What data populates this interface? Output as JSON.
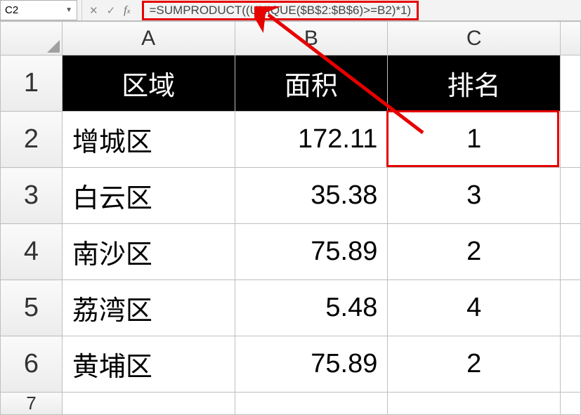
{
  "name_box": {
    "ref": "C2"
  },
  "formula_bar": {
    "formula": "=SUMPRODUCT((UNIQUE($B$2:$B$6)>=B2)*1)"
  },
  "col_headers": [
    "A",
    "B",
    "C"
  ],
  "row_headers": [
    "1",
    "2",
    "3",
    "4",
    "5",
    "6",
    "7"
  ],
  "header_row": {
    "A": "区域",
    "B": "面积",
    "C": "排名"
  },
  "rows": [
    {
      "A": "增城区",
      "B": "172.11",
      "C": "1"
    },
    {
      "A": "白云区",
      "B": "35.38",
      "C": "3"
    },
    {
      "A": "南沙区",
      "B": "75.89",
      "C": "2"
    },
    {
      "A": "荔湾区",
      "B": "5.48",
      "C": "4"
    },
    {
      "A": "黄埔区",
      "B": "75.89",
      "C": "2"
    }
  ],
  "selected_cell": "C2",
  "chart_data": {
    "type": "table",
    "columns": [
      "区域",
      "面积",
      "排名"
    ],
    "data": [
      [
        "增城区",
        172.11,
        1
      ],
      [
        "白云区",
        35.38,
        3
      ],
      [
        "南沙区",
        75.89,
        2
      ],
      [
        "荔湾区",
        5.48,
        4
      ],
      [
        "黄埔区",
        75.89,
        2
      ]
    ]
  }
}
